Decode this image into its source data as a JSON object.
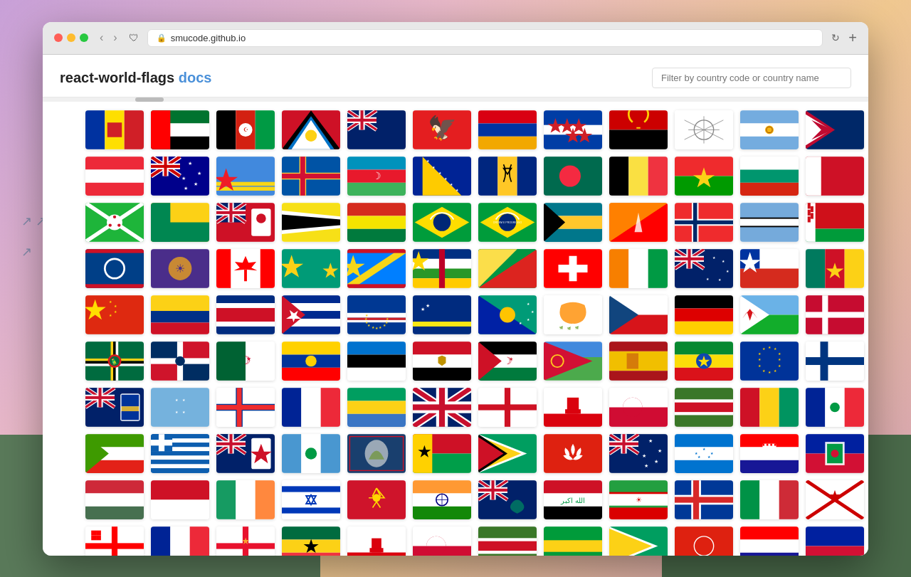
{
  "background": {
    "gradient": "purple-to-orange"
  },
  "browser": {
    "url": "smucode.github.io",
    "traffic_lights": {
      "red": "#ff5f57",
      "yellow": "#febc2e",
      "green": "#28c840"
    }
  },
  "header": {
    "title_plain": "react-world-flags",
    "title_link": "docs",
    "title_link_url": "#",
    "search_placeholder": "Filter by country code or country name"
  },
  "flags": {
    "rows": [
      [
        "AD",
        "AE",
        "AF",
        "AG",
        "AI",
        "AL",
        "AM",
        "AN",
        "AO",
        "AQ",
        "AR",
        "AS"
      ],
      [
        "AT",
        "AU",
        "AW",
        "AX",
        "AZ",
        "BA",
        "BB",
        "BD",
        "BE",
        "BF",
        "BG",
        "BH"
      ],
      [
        "BI",
        "BJ",
        "BM",
        "BN",
        "BO",
        "BR_old",
        "BR",
        "BS",
        "BT",
        "BV",
        "BW",
        "BY"
      ],
      [
        "BZ",
        "CA_native",
        "CA",
        "CC",
        "CD",
        "CF",
        "CG",
        "CH",
        "CI",
        "CK",
        "CL",
        "CM"
      ],
      [
        "CN",
        "CO",
        "CR",
        "CU",
        "CV",
        "CW",
        "CX",
        "CY",
        "CZ",
        "DE",
        "DJ",
        "DK"
      ],
      [
        "DM",
        "DO",
        "DZ",
        "EC",
        "EE",
        "EG",
        "EH",
        "ER",
        "ES",
        "ET",
        "EU",
        "FI"
      ],
      [
        "FK",
        "FM",
        "FO",
        "FR",
        "GA",
        "GB",
        "GD_en",
        "GI",
        "GL",
        "GM",
        "GN",
        "GP"
      ],
      [
        "GQ",
        "GR",
        "GS",
        "GT",
        "GU",
        "GW",
        "GY",
        "HK",
        "HM",
        "HN",
        "HR",
        "HT"
      ],
      [
        "HU",
        "ID",
        "IE",
        "IL",
        "IM",
        "IN",
        "IO",
        "IQ",
        "IR",
        "IS",
        "IT",
        "JE"
      ]
    ]
  }
}
